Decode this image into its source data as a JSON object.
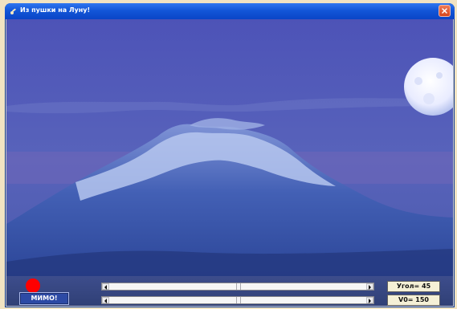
{
  "window": {
    "title": "Из пушки на Луну!",
    "close_icon": "close-icon",
    "app_icon": "cannon-icon"
  },
  "scene": {
    "background": "mountain-night-sky",
    "moon_icon": "moon-icon",
    "accent_colors": {
      "sky": "#4f57b8",
      "snow": "#c8d6f2",
      "mountain": "#3450a6",
      "cannonball": "#ff0000"
    }
  },
  "controls": {
    "result_label": "МИМО!",
    "angle_label": "Угол= 45",
    "speed_label": "V0= 150",
    "angle_level": 0.5,
    "speed_level": 0.5
  }
}
